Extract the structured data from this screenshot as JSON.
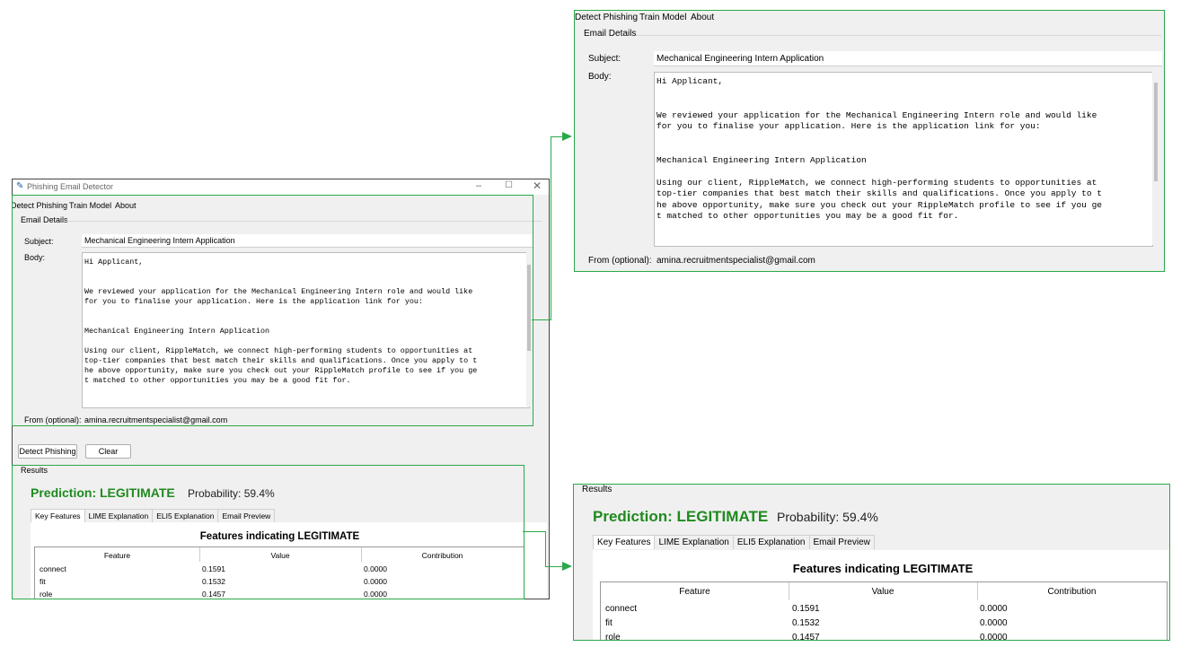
{
  "window": {
    "title": "Phishing Email Detector"
  },
  "menu": {
    "tabs": [
      "Detect Phishing",
      "Train Model",
      "About"
    ]
  },
  "email_details": {
    "group_label": "Email Details",
    "subject_label": "Subject:",
    "subject_value": "Mechanical Engineering Intern Application",
    "body_label": "Body:",
    "from_label": "From (optional):",
    "from_value": "amina.recruitmentspecialist@gmail.com"
  },
  "body_left": "Hi Applicant,\n\n\nWe reviewed your application for the Mechanical Engineering Intern role and would like\nfor you to finalise your application. Here is the application link for you:\n\n\nMechanical Engineering Intern Application\n\nUsing our client, RippleMatch, we connect high-performing students to opportunities at\ntop-tier companies that best match their skills and qualifications. Once you apply to t\nhe above opportunity, make sure you check out your RippleMatch profile to see if you ge\nt matched to other opportunities you may be a good fit for.",
  "body_right": "Hi Applicant,\n\n\nWe reviewed your application for the Mechanical Engineering Intern role and would like\nfor you to finalise your application. Here is the application link for you:\n\n\nMechanical Engineering Intern Application\n\nUsing our client, RippleMatch, we connect high-performing students to opportunities at\ntop-tier companies that best match their skills and qualifications. Once you apply to t\nhe above opportunity, make sure you check out your RippleMatch profile to see if you ge\nt matched to other opportunities you may be a good fit for.",
  "actions": {
    "detect_label": "Detect Phishing",
    "clear_label": "Clear"
  },
  "results": {
    "group_label": "Results",
    "prediction": "Prediction: LEGITIMATE",
    "probability": "Probability: 59.4%",
    "tabs": [
      "Key Features",
      "LIME Explanation",
      "ELI5 Explanation",
      "Email Preview"
    ],
    "features_title": "Features indicating LEGITIMATE",
    "columns": [
      "Feature",
      "Value",
      "Contribution"
    ],
    "rows": [
      [
        "connect",
        "0.1591",
        "0.0000"
      ],
      [
        "fit",
        "0.1532",
        "0.0000"
      ],
      [
        "role",
        "0.1457",
        "0.0000"
      ]
    ]
  },
  "colors": {
    "highlight": "#2aa84a",
    "prediction": "#1f8a1f"
  },
  "icons": {
    "app": "feather-icon",
    "minimize": "minimize-icon",
    "maximize": "maximize-icon",
    "close": "close-icon"
  }
}
